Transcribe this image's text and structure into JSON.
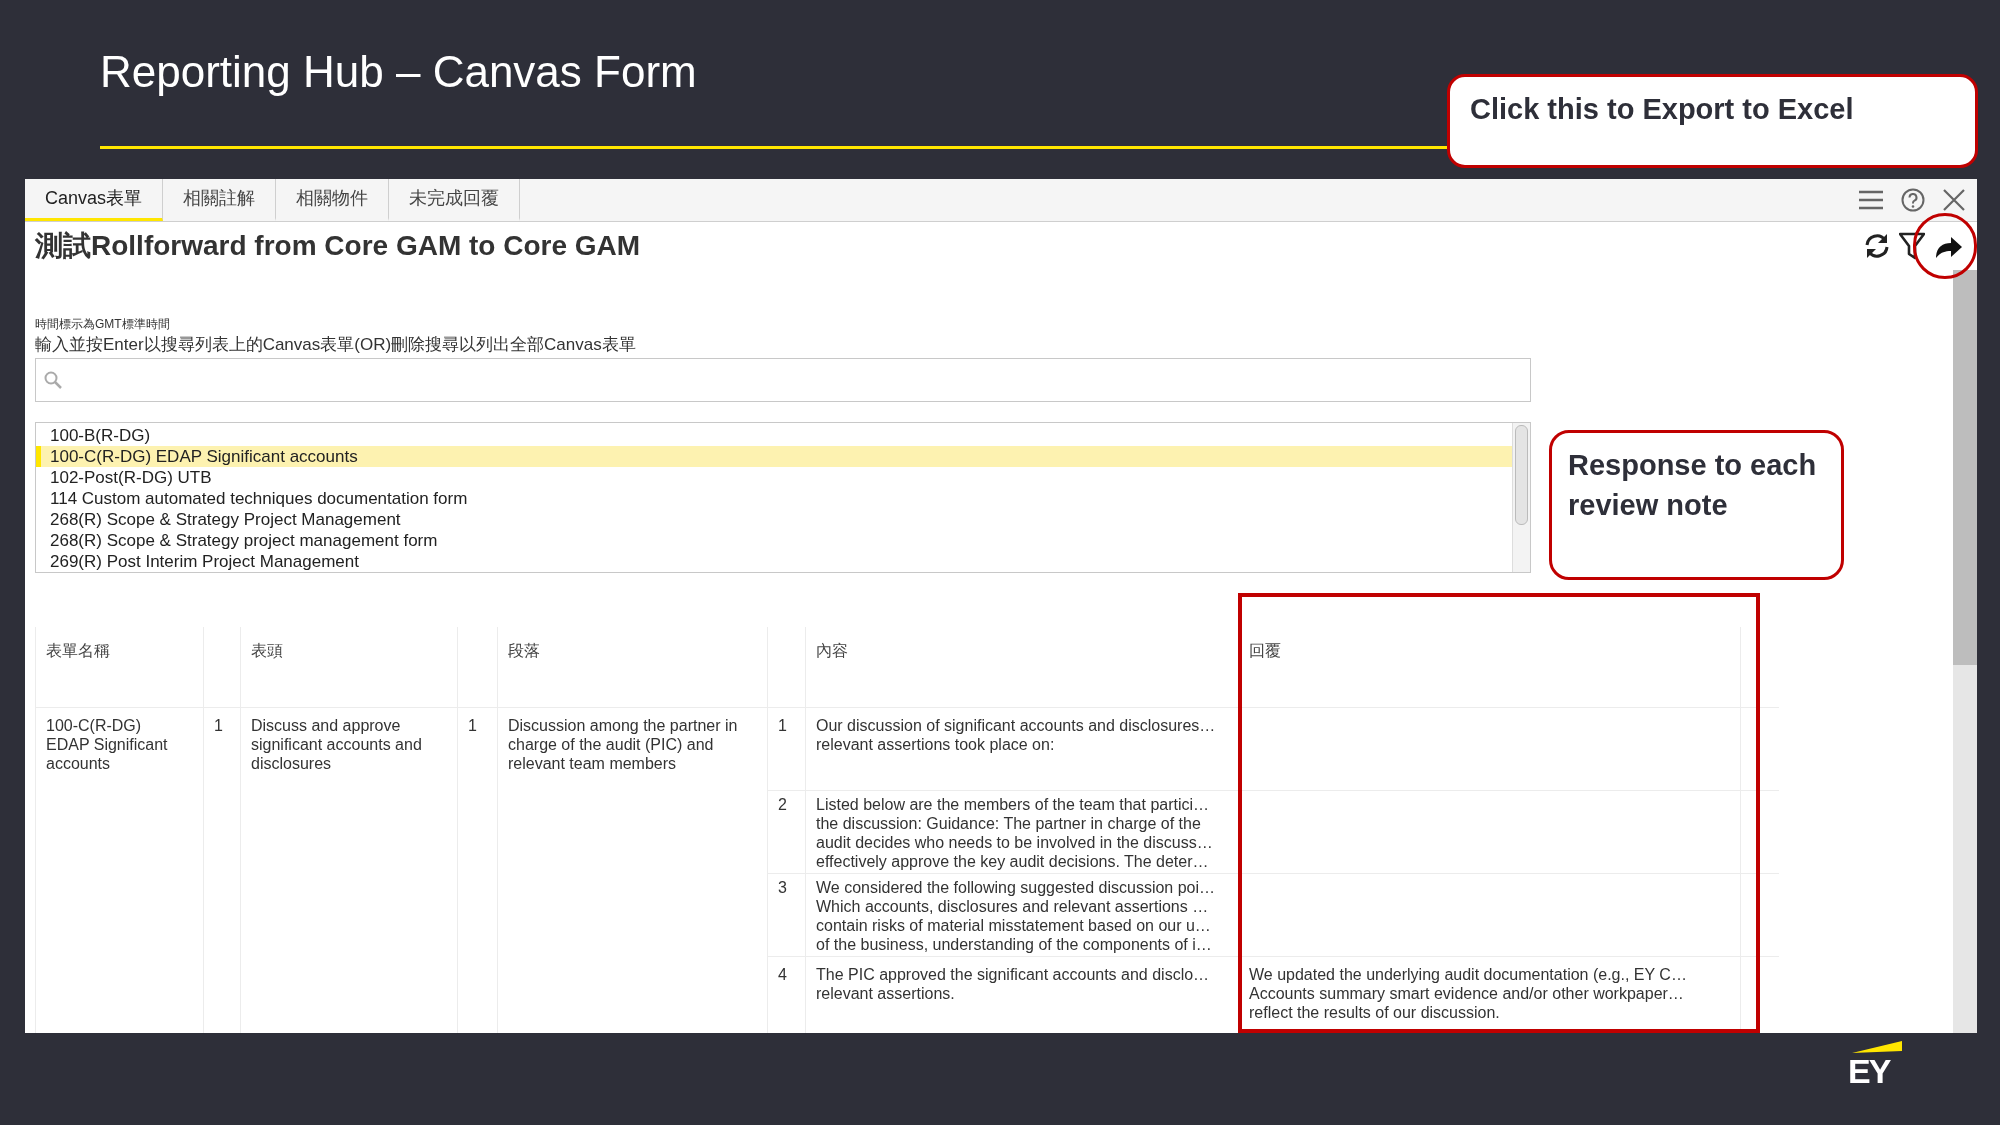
{
  "slide": {
    "title": "Reporting Hub – Canvas Form",
    "logo": "EY"
  },
  "callouts": [
    {
      "text": "Click this to Export to Excel"
    },
    {
      "text": "Response to each review note"
    }
  ],
  "app": {
    "tabs": [
      {
        "label": "Canvas表單",
        "selected": true
      },
      {
        "label": "相關註解",
        "selected": false
      },
      {
        "label": "相關物件",
        "selected": false
      },
      {
        "label": "未完成回覆",
        "selected": false
      }
    ],
    "heading": "測試Rollforward from Core GAM to Core GAM",
    "timezone_note": "時間標示為GMT標準時間",
    "search_instruction": "輸入並按Enter以搜尋列表上的Canvas表單(OR)刪除搜尋以列出全部Canvas表單",
    "forms": [
      {
        "label": "100-B(R-DG)",
        "selected": false
      },
      {
        "label": "100-C(R-DG) EDAP Significant accounts",
        "selected": true
      },
      {
        "label": "102-Post(R-DG) UTB",
        "selected": false
      },
      {
        "label": "114 Custom automated techniques documentation form",
        "selected": false
      },
      {
        "label": "268(R) Scope & Strategy Project Management",
        "selected": false
      },
      {
        "label": "268(R) Scope & Strategy project management form",
        "selected": false
      },
      {
        "label": "269(R) Post Interim Project Management",
        "selected": false
      }
    ],
    "table": {
      "columns": [
        "表單名稱",
        "表頭",
        "段落",
        "內容",
        "回覆"
      ],
      "form_name": "100-C(R-DG)\nEDAP Significant\naccounts",
      "header_no": "1",
      "header": "Discuss and approve\nsignificant accounts and\ndisclosures",
      "paragraph_no": "1",
      "paragraph": "Discussion among the partner in\ncharge of the audit (PIC) and\nrelevant team members",
      "items": [
        {
          "no": "1",
          "content": "Our discussion of significant accounts and disclosures…\nrelevant assertions took place on:"
        },
        {
          "no": "2",
          "content": "Listed below are the members of the team that partici…\nthe discussion: Guidance: The partner in charge of the\naudit decides who needs to be involved in the discuss…\neffectively approve the key audit decisions. The deter…"
        },
        {
          "no": "3",
          "content": "We considered the following suggested discussion poi…\nWhich accounts, disclosures and relevant assertions …\ncontain risks of material misstatement based on our u…\nof the business, understanding of the components of i…"
        },
        {
          "no": "4",
          "content": "The PIC approved the significant accounts and disclo…\nrelevant assertions.",
          "response": "We updated the underlying audit documentation (e.g., EY C…\nAccounts summary smart evidence and/or other workpaper…\nreflect the results of our discussion."
        }
      ]
    }
  }
}
